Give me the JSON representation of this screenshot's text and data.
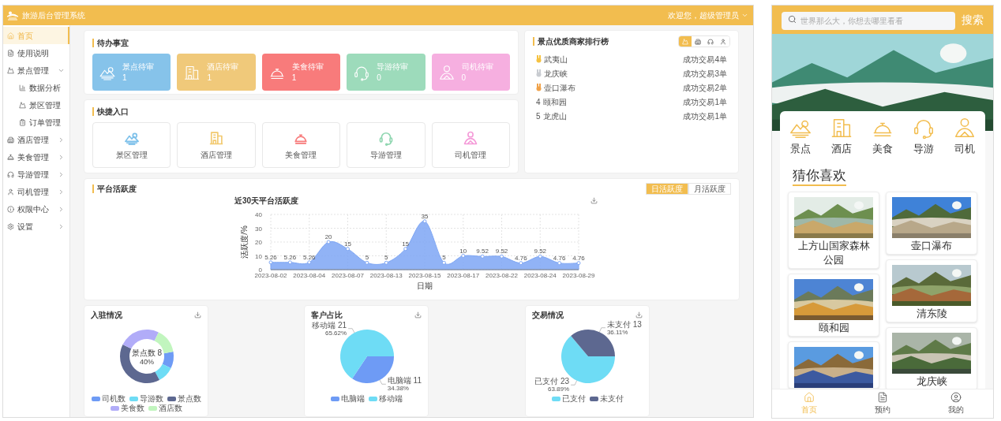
{
  "header": {
    "title": "旅游后台管理系统",
    "user": "欢迎您，超级管理员"
  },
  "sidebar": {
    "items": [
      {
        "label": "首页",
        "selected": true
      },
      {
        "label": "使用说明",
        "selected": false
      },
      {
        "label": "景点管理",
        "selected": false,
        "expanded": true,
        "children": [
          {
            "label": "数据分析",
            "selected": false
          },
          {
            "label": "景区管理",
            "selected": false
          },
          {
            "label": "订单管理",
            "selected": false
          }
        ]
      },
      {
        "label": "酒店管理",
        "selected": false,
        "expanded": false
      },
      {
        "label": "美食管理",
        "selected": false,
        "expanded": false
      },
      {
        "label": "导游管理",
        "selected": false,
        "expanded": false
      },
      {
        "label": "司机管理",
        "selected": false,
        "expanded": false
      },
      {
        "label": "权限中心",
        "selected": false,
        "expanded": false
      },
      {
        "label": "设置",
        "selected": false,
        "expanded": false
      }
    ]
  },
  "todo": {
    "title": "待办事宜",
    "cards": [
      {
        "label": "景点待审",
        "count": "1",
        "color": "#86c3ea"
      },
      {
        "label": "酒店待审",
        "count": "1",
        "color": "#f0c97a"
      },
      {
        "label": "美食待审",
        "count": "1",
        "color": "#f87b7b"
      },
      {
        "label": "导游待审",
        "count": "0",
        "color": "#9ddbbb"
      },
      {
        "label": "司机待审",
        "count": "0",
        "color": "#f6afe0"
      }
    ]
  },
  "shortcuts": {
    "title": "快捷入口",
    "items": [
      {
        "label": "景区管理",
        "color": "#7cc0ea"
      },
      {
        "label": "酒店管理",
        "color": "#f2c96e"
      },
      {
        "label": "美食管理",
        "color": "#f77a7a"
      },
      {
        "label": "导游管理",
        "color": "#8fd6b0"
      },
      {
        "label": "司机管理",
        "color": "#f49ad8"
      }
    ]
  },
  "ranking": {
    "title": "景点优质商家排行榜",
    "tabs": [
      {
        "selected": true
      },
      {
        "selected": false
      },
      {
        "selected": false
      },
      {
        "selected": false
      }
    ],
    "rows": [
      {
        "kind": "medal",
        "color": "#f5c242",
        "name": "武夷山",
        "deals": "成功交易4单"
      },
      {
        "kind": "medal",
        "color": "#c9ccd1",
        "name": "龙庆峡",
        "deals": "成功交易3单"
      },
      {
        "kind": "medal",
        "color": "#f0a24a",
        "name": "壶口瀑布",
        "deals": "成功交易2单"
      },
      {
        "kind": "number",
        "rank": "4",
        "name": "颐和园",
        "deals": "成功交易1单"
      },
      {
        "kind": "number",
        "rank": "5",
        "name": "龙虎山",
        "deals": "成功交易1单"
      }
    ]
  },
  "activity": {
    "title": "平台活跃度",
    "tabs": [
      {
        "label": "日活跃度",
        "selected": true
      },
      {
        "label": "月活跃度",
        "selected": false
      }
    ],
    "chart_data": {
      "type": "area",
      "title": "近30天平台活跃度",
      "xlabel": "日期",
      "ylabel": "活跃度/%",
      "categories": [
        "2023-08-02",
        null,
        "2023-08-04",
        null,
        "2023-08-07",
        null,
        "2023-08-13",
        null,
        "2023-08-15",
        null,
        "2023-08-17",
        null,
        "2023-08-22",
        null,
        "2023-08-24",
        null,
        "2023-08-29"
      ],
      "ylim": [
        0,
        40
      ],
      "yticks": [
        0,
        10,
        20,
        30,
        40
      ],
      "grid": true,
      "series": [
        {
          "color": "#7ea6f4",
          "values": [
            5.26,
            5.26,
            5.26,
            20,
            15,
            5,
            5,
            15,
            35,
            5,
            10,
            9.52,
            9.52,
            4.76,
            9.52,
            4.76,
            4.76
          ]
        }
      ],
      "data_labels": true
    }
  },
  "stats": [
    {
      "title": "入驻情况",
      "chart_data": {
        "type": "donut",
        "categories": [
          "司机数",
          "导游数",
          "景点数",
          "美食数",
          "酒店数"
        ],
        "values": [
          10,
          10,
          40,
          25,
          15
        ],
        "colors": [
          "#6e9bf5",
          "#6edcf5",
          "#5d6890",
          "#b1acf8",
          "#c1f5be"
        ]
      },
      "slice_labels": [
        {
          "kind": "center",
          "text": "景点数 8",
          "percent": "40%"
        }
      ]
    },
    {
      "title": "客户占比",
      "chart_data": {
        "type": "pie",
        "categories": [
          "电脑端",
          "移动端"
        ],
        "values": [
          34.38,
          65.62
        ],
        "colors": [
          "#6e9bf5",
          "#6edcf5"
        ]
      },
      "slice_labels": [
        {
          "kind": "outside",
          "text": "移动端 21",
          "percent": "65.62%"
        },
        {
          "kind": "outside",
          "text": "电脑端 11",
          "percent": "34.38%"
        }
      ]
    },
    {
      "title": "交易情况",
      "chart_data": {
        "type": "pie",
        "categories": [
          "已支付",
          "未支付"
        ],
        "values": [
          63.89,
          36.11
        ],
        "colors": [
          "#6edcf5",
          "#5d6890"
        ]
      },
      "slice_labels": [
        {
          "kind": "outside",
          "text": "未支付 13",
          "percent": "36.11%"
        },
        {
          "kind": "outside",
          "text": "已支付 23",
          "percent": "63.89%"
        }
      ]
    }
  ],
  "mobile": {
    "search": {
      "placeholder": "世界那么大，你想去哪里看看",
      "button": "搜索"
    },
    "categories": [
      "景点",
      "酒店",
      "美食",
      "导游",
      "司机"
    ],
    "recommend": {
      "title": "猜你喜欢",
      "columns": [
        [
          {
            "title": "上方山国家森林公园"
          },
          {
            "title": "颐和园"
          },
          {
            "kind": "picture"
          }
        ],
        [
          {
            "title": "壶口瀑布"
          },
          {
            "title": "清东陵"
          },
          {
            "title": "龙庆峡"
          }
        ]
      ]
    },
    "tabbar": [
      {
        "label": "首页",
        "selected": true
      },
      {
        "label": "预约",
        "selected": false
      },
      {
        "label": "我的",
        "selected": false
      }
    ]
  }
}
